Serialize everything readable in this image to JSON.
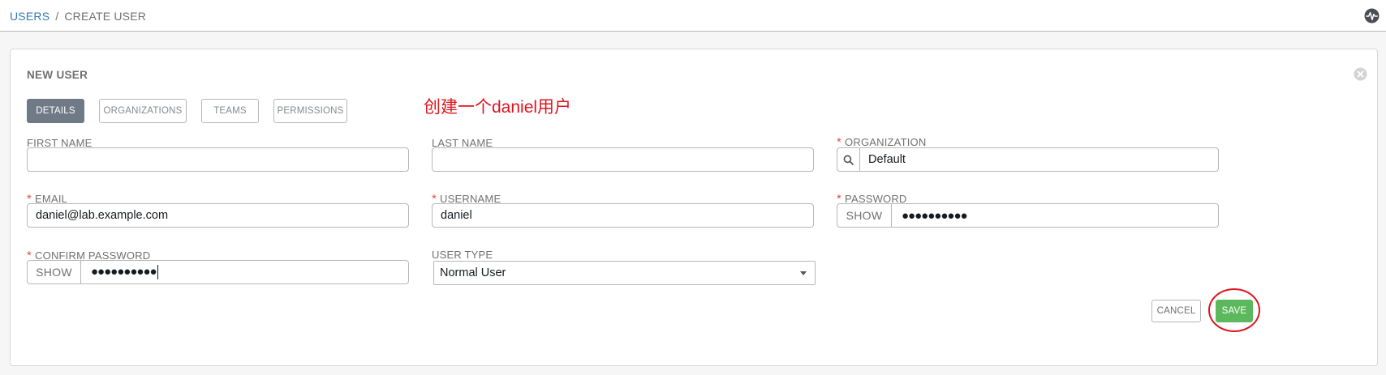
{
  "breadcrumb": {
    "parent": "USERS",
    "separator": "/",
    "current": "CREATE USER"
  },
  "header": {
    "activity_icon": "activity-stream-icon"
  },
  "panel": {
    "title": "NEW USER",
    "close_icon": "close-icon",
    "tabs": [
      {
        "label": "DETAILS",
        "active": true
      },
      {
        "label": "ORGANIZATIONS",
        "active": false
      },
      {
        "label": "TEAMS",
        "active": false
      },
      {
        "label": "PERMISSIONS",
        "active": false
      }
    ],
    "annotation": "创建一个daniel用户"
  },
  "form": {
    "first_name": {
      "label": "FIRST NAME",
      "value": ""
    },
    "last_name": {
      "label": "LAST NAME",
      "value": ""
    },
    "organization": {
      "label": "ORGANIZATION",
      "required": "*",
      "value": "Default",
      "icon": "search-icon"
    },
    "email": {
      "label": "EMAIL",
      "required": "*",
      "value": "daniel@lab.example.com"
    },
    "username": {
      "label": "USERNAME",
      "required": "*",
      "value": "daniel"
    },
    "password": {
      "label": "PASSWORD",
      "required": "*",
      "show_label": "SHOW",
      "masked": "●●●●●●●●●●"
    },
    "confirm_password": {
      "label": "CONFIRM PASSWORD",
      "required": "*",
      "show_label": "SHOW",
      "masked": "●●●●●●●●●●"
    },
    "user_type": {
      "label": "USER TYPE",
      "value": "Normal User"
    }
  },
  "actions": {
    "cancel_label": "CANCEL",
    "save_label": "SAVE"
  },
  "colors": {
    "link": "#337ab7",
    "required": "#d9534f",
    "save": "#5cb85c",
    "annotation": "#e0141e",
    "active_tab": "#707a87"
  }
}
